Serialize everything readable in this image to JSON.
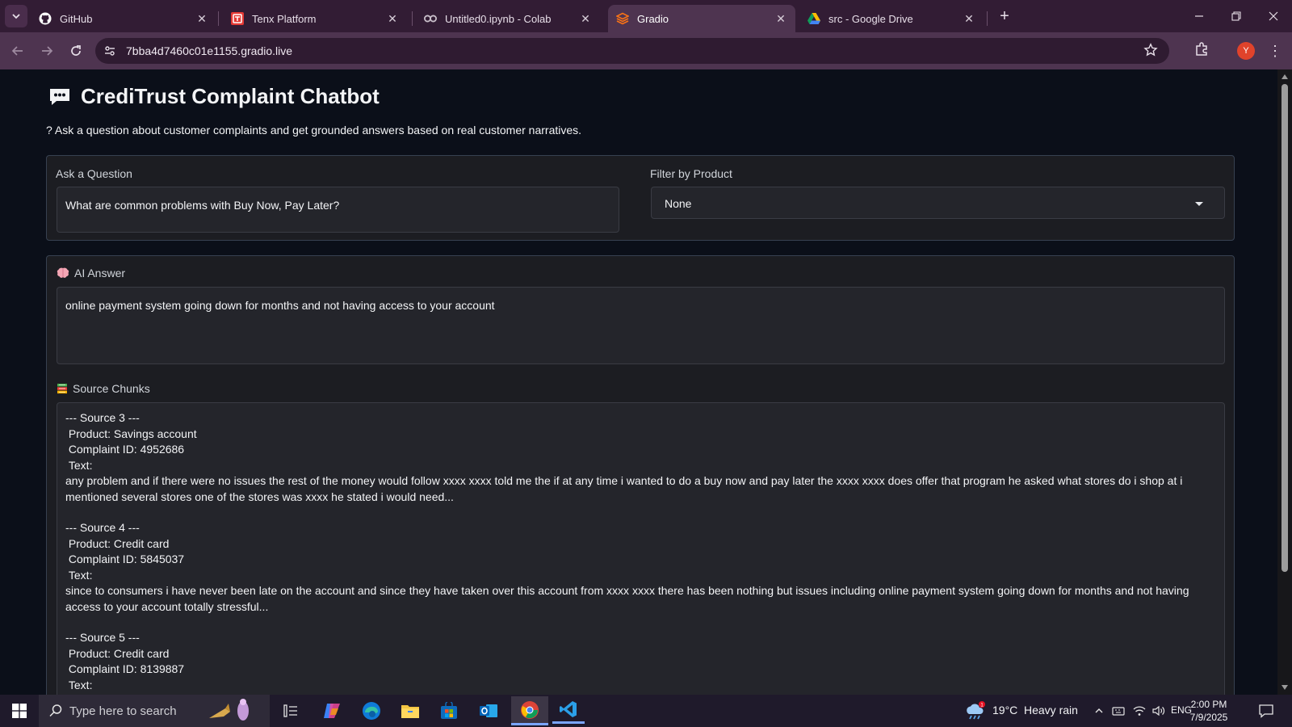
{
  "browser": {
    "tabs": [
      {
        "title": "GitHub",
        "icon": "github-icon"
      },
      {
        "title": "Tenx Platform",
        "icon": "tenx-icon"
      },
      {
        "title": "Untitled0.ipynb - Colab",
        "icon": "colab-icon"
      },
      {
        "title": "Gradio",
        "icon": "gradio-icon",
        "active": true
      },
      {
        "title": "src - Google Drive",
        "icon": "google-drive-icon"
      }
    ],
    "url": "7bba4d7460c01e1155.gradio.live",
    "profile_initial": "Y"
  },
  "app": {
    "title": "CrediTrust Complaint Chatbot",
    "subtitle": "? Ask a question about customer complaints and get grounded answers based on real customer narratives.",
    "question": {
      "label": "Ask a Question",
      "value": "What are common problems with Buy Now, Pay Later?"
    },
    "filter": {
      "label": "Filter by Product",
      "value": "None"
    },
    "answer": {
      "label": "AI Answer",
      "value": "online payment system going down for months and not having access to your account"
    },
    "sources": {
      "label": "Source Chunks",
      "blocks": [
        {
          "header": "--- Source 3 ---",
          "product": " Product: Savings account",
          "complaint": " Complaint ID: 4952686",
          "text_label": " Text:",
          "text": "any problem and if there were no issues the rest of the money would follow xxxx xxxx told me the if at any time i wanted to do a buy now and pay later the xxxx xxxx does offer that program he asked what stores do i shop at i mentioned several stores one of the stores was xxxx he stated i would need..."
        },
        {
          "header": "--- Source 4 ---",
          "product": " Product: Credit card",
          "complaint": " Complaint ID: 5845037",
          "text_label": " Text:",
          "text": "since to consumers i have never been late on the account and since they have taken over this account from xxxx xxxx there has been nothing but issues including online payment system going down for months and not having access to your account totally stressful..."
        },
        {
          "header": "--- Source 5 ---",
          "product": " Product: Credit card",
          "complaint": " Complaint ID: 8139887",
          "text_label": " Text:",
          "text": ""
        }
      ]
    }
  },
  "taskbar": {
    "search_placeholder": "Type here to search",
    "weather_temp": "19°C",
    "weather_desc": "Heavy rain",
    "language": "ENG",
    "time": "2:00 PM",
    "date": "7/9/2025"
  }
}
